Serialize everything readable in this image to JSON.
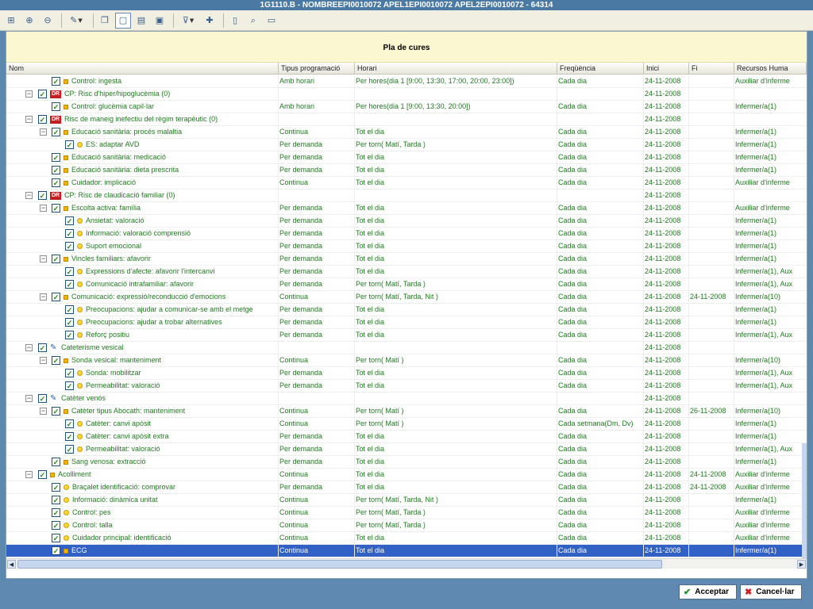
{
  "window": {
    "title": "1G1110.B - NOMBREEPI0010072 APEL1EPI0010072 APEL2EPI0010072 - 64314"
  },
  "toolbar": {
    "buttons": [
      {
        "name": "expand-tree-icon",
        "glyph": "⊞"
      },
      {
        "name": "add-node-icon",
        "glyph": "⊕"
      },
      {
        "name": "remove-node-icon",
        "glyph": "⊖"
      },
      {
        "name": "edit-pencil-icon",
        "glyph": "✎",
        "dropdown": true
      },
      {
        "name": "copy-icon",
        "glyph": "❐"
      },
      {
        "name": "page-view-icon",
        "glyph": "▢",
        "active": true
      },
      {
        "name": "book-icon",
        "glyph": "▤"
      },
      {
        "name": "window-icon",
        "glyph": "▣"
      },
      {
        "name": "filter-icon",
        "glyph": "⊽",
        "dropdown": true
      },
      {
        "name": "pin-icon",
        "glyph": "✚"
      },
      {
        "name": "document-icon",
        "glyph": "▯"
      },
      {
        "name": "search-icon",
        "glyph": "⌕"
      },
      {
        "name": "monitor-icon",
        "glyph": "▭"
      }
    ]
  },
  "plan": {
    "title": "Pla de cures"
  },
  "columns": [
    "Nom",
    "Tipus programació",
    "Horari",
    "Freqüència",
    "Inici",
    "Fi",
    "Recursos Huma"
  ],
  "rows": [
    {
      "level": 3,
      "icon": "sq",
      "name": "Control: ingesta",
      "tipus": "Amb horari",
      "horari": "Per hores(dia 1 [9:00, 13:30, 17:00, 20:00, 23:00])",
      "freq": "Cada dia",
      "inici": "24-11-2008",
      "fi": "",
      "rec": "Auxiliar d'inferme"
    },
    {
      "level": 1,
      "exp": "−",
      "icon": "dr",
      "name": "CP: Risc d'hiper/hipoglucèmia (0)",
      "tipus": "",
      "horari": "",
      "freq": "",
      "inici": "24-11-2008",
      "fi": "",
      "rec": ""
    },
    {
      "level": 3,
      "icon": "sq",
      "name": "Control: glucèmia capil·lar",
      "tipus": "Amb horari",
      "horari": "Per hores(dia 1 [9:00, 13:30, 20:00])",
      "freq": "Cada dia",
      "inici": "24-11-2008",
      "fi": "",
      "rec": "Infermer/a(1)"
    },
    {
      "level": 1,
      "exp": "−",
      "icon": "dr",
      "name": "Risc de maneig inefectiu del règim terapèutic (0)",
      "tipus": "",
      "horari": "",
      "freq": "",
      "inici": "24-11-2008",
      "fi": "",
      "rec": ""
    },
    {
      "level": 2,
      "exp": "−",
      "icon": "sq",
      "name": "Educació sanitària: procés malaltia",
      "tipus": "Continua",
      "horari": "Tot el dia",
      "freq": "Cada dia",
      "inici": "24-11-2008",
      "fi": "",
      "rec": "Infermer/a(1)"
    },
    {
      "level": 4,
      "icon": "circ",
      "name": "ES: adaptar AVD",
      "tipus": "Per demanda",
      "horari": "Per torn( Matí, Tarda )",
      "freq": "Cada dia",
      "inici": "24-11-2008",
      "fi": "",
      "rec": "Infermer/a(1)"
    },
    {
      "level": 3,
      "icon": "sq",
      "name": "Educació sanitària: medicació",
      "tipus": "Per demanda",
      "horari": "Tot el dia",
      "freq": "Cada dia",
      "inici": "24-11-2008",
      "fi": "",
      "rec": "Infermer/a(1)"
    },
    {
      "level": 3,
      "icon": "sq",
      "name": "Educació sanitària: dieta prescrita",
      "tipus": "Per demanda",
      "horari": "Tot el dia",
      "freq": "Cada dia",
      "inici": "24-11-2008",
      "fi": "",
      "rec": "Infermer/a(1)"
    },
    {
      "level": 3,
      "icon": "sq",
      "name": "Cuidador: implicació",
      "tipus": "Continua",
      "horari": "Tot el dia",
      "freq": "Cada dia",
      "inici": "24-11-2008",
      "fi": "",
      "rec": "Auxiliar d'inferme"
    },
    {
      "level": 1,
      "exp": "−",
      "icon": "dr",
      "name": "CP: Risc de claudicació familiar (0)",
      "tipus": "",
      "horari": "",
      "freq": "",
      "inici": "24-11-2008",
      "fi": "",
      "rec": ""
    },
    {
      "level": 2,
      "exp": "−",
      "icon": "sq",
      "name": "Escolta activa: família",
      "tipus": "Per demanda",
      "horari": "Tot el dia",
      "freq": "Cada dia",
      "inici": "24-11-2008",
      "fi": "",
      "rec": "Auxiliar d'inferme"
    },
    {
      "level": 4,
      "icon": "circ",
      "name": "Ansietat: valoració",
      "tipus": "Per demanda",
      "horari": "Tot el dia",
      "freq": "Cada dia",
      "inici": "24-11-2008",
      "fi": "",
      "rec": "Infermer/a(1)"
    },
    {
      "level": 4,
      "icon": "circ",
      "name": "Informació: valoració comprensió",
      "tipus": "Per demanda",
      "horari": "Tot el dia",
      "freq": "Cada dia",
      "inici": "24-11-2008",
      "fi": "",
      "rec": "Infermer/a(1)"
    },
    {
      "level": 4,
      "icon": "circ",
      "name": "Suport emocional",
      "tipus": "Per demanda",
      "horari": "Tot el dia",
      "freq": "Cada dia",
      "inici": "24-11-2008",
      "fi": "",
      "rec": "Infermer/a(1)"
    },
    {
      "level": 2,
      "exp": "−",
      "icon": "sq",
      "name": "Vincles familiars: afavorir",
      "tipus": "Per demanda",
      "horari": "Tot el dia",
      "freq": "Cada dia",
      "inici": "24-11-2008",
      "fi": "",
      "rec": "Infermer/a(1)"
    },
    {
      "level": 4,
      "icon": "circ",
      "name": "Expressions d'afecte: afavorir l'intercanvi",
      "tipus": "Per demanda",
      "horari": "Tot el dia",
      "freq": "Cada dia",
      "inici": "24-11-2008",
      "fi": "",
      "rec": "Infermer/a(1), Aux"
    },
    {
      "level": 4,
      "icon": "circ",
      "name": "Comunicació intrafamiliar: afavorir",
      "tipus": "Per demanda",
      "horari": "Per torn( Matí, Tarda )",
      "freq": "Cada dia",
      "inici": "24-11-2008",
      "fi": "",
      "rec": "Infermer/a(1), Aux"
    },
    {
      "level": 2,
      "exp": "−",
      "icon": "sq",
      "name": "Comunicació: expressió/reconducció d'emocions",
      "tipus": "Continua",
      "horari": "Per torn( Matí, Tarda, Nit )",
      "freq": "Cada dia",
      "inici": "24-11-2008",
      "fi": "24-11-2008",
      "rec": "Infermer/a(10)"
    },
    {
      "level": 4,
      "icon": "circ",
      "name": "Preocupacions: ajudar a comunicar-se amb el metge",
      "tipus": "Per demanda",
      "horari": "Tot el dia",
      "freq": "Cada dia",
      "inici": "24-11-2008",
      "fi": "",
      "rec": "Infermer/a(1)"
    },
    {
      "level": 4,
      "icon": "circ",
      "name": "Preocupacions: ajudar a trobar alternatives",
      "tipus": "Per demanda",
      "horari": "Tot el dia",
      "freq": "Cada dia",
      "inici": "24-11-2008",
      "fi": "",
      "rec": "Infermer/a(1)"
    },
    {
      "level": 4,
      "icon": "circ",
      "name": "Reforç positiu",
      "tipus": "Per demanda",
      "horari": "Tot el dia",
      "freq": "Cada dia",
      "inici": "24-11-2008",
      "fi": "",
      "rec": "Infermer/a(1), Aux"
    },
    {
      "level": 1,
      "exp": "−",
      "icon": "pen",
      "name": "Cateterisme vesical",
      "tipus": "",
      "horari": "",
      "freq": "",
      "inici": "24-11-2008",
      "fi": "",
      "rec": ""
    },
    {
      "level": 2,
      "exp": "−",
      "icon": "sq",
      "name": "Sonda vesical: manteniment",
      "tipus": "Continua",
      "horari": "Per torn( Matí )",
      "freq": "Cada dia",
      "inici": "24-11-2008",
      "fi": "",
      "rec": "Infermer/a(10)"
    },
    {
      "level": 4,
      "icon": "circ",
      "name": "Sonda: mobilitzar",
      "tipus": "Per demanda",
      "horari": "Tot el dia",
      "freq": "Cada dia",
      "inici": "24-11-2008",
      "fi": "",
      "rec": "Infermer/a(1), Aux"
    },
    {
      "level": 4,
      "icon": "circ",
      "name": "Permeabilitat: valoració",
      "tipus": "Per demanda",
      "horari": "Tot el dia",
      "freq": "Cada dia",
      "inici": "24-11-2008",
      "fi": "",
      "rec": "Infermer/a(1), Aux"
    },
    {
      "level": 1,
      "exp": "−",
      "icon": "pen",
      "name": "Catèter venós",
      "tipus": "",
      "horari": "",
      "freq": "",
      "inici": "24-11-2008",
      "fi": "",
      "rec": ""
    },
    {
      "level": 2,
      "exp": "−",
      "icon": "sq",
      "name": "Catèter tipus Abocath: manteniment",
      "tipus": "Continua",
      "horari": "Per torn( Matí )",
      "freq": "Cada dia",
      "inici": "24-11-2008",
      "fi": "26-11-2008",
      "rec": "Infermer/a(10)"
    },
    {
      "level": 4,
      "icon": "circ",
      "name": "Catèter: canvi apòsit",
      "tipus": "Continua",
      "horari": "Per torn( Matí )",
      "freq": "Cada setmana(Dm, Dv)",
      "inici": "24-11-2008",
      "fi": "",
      "rec": "Infermer/a(1)"
    },
    {
      "level": 4,
      "icon": "circ",
      "name": "Catèter: canvi apòsit extra",
      "tipus": "Per demanda",
      "horari": "Tot el dia",
      "freq": "Cada dia",
      "inici": "24-11-2008",
      "fi": "",
      "rec": "Infermer/a(1)"
    },
    {
      "level": 4,
      "icon": "circ",
      "name": "Permeabilitat: valoració",
      "tipus": "Per demanda",
      "horari": "Tot el dia",
      "freq": "Cada dia",
      "inici": "24-11-2008",
      "fi": "",
      "rec": "Infermer/a(1), Aux"
    },
    {
      "level": 2,
      "icon": "sq",
      "name": "Sang venosa: extracció",
      "tipus": "Per demanda",
      "horari": "Tot el dia",
      "freq": "Cada dia",
      "inici": "24-11-2008",
      "fi": "",
      "rec": "Infermer/a(1)"
    },
    {
      "level": 1,
      "exp": "−",
      "icon": "sq",
      "name": "Acolliment",
      "tipus": "Continua",
      "horari": "Tot el dia",
      "freq": "Cada dia",
      "inici": "24-11-2008",
      "fi": "24-11-2008",
      "rec": "Auxiliar d'inferme"
    },
    {
      "level": 3,
      "icon": "circ",
      "name": "Braçalet identificació: comprovar",
      "tipus": "Per demanda",
      "horari": "Tot el dia",
      "freq": "Cada dia",
      "inici": "24-11-2008",
      "fi": "24-11-2008",
      "rec": "Auxiliar d'inferme"
    },
    {
      "level": 3,
      "icon": "circ",
      "name": "Informació: dinàmica unitat",
      "tipus": "Continua",
      "horari": "Per torn( Matí, Tarda, Nit )",
      "freq": "Cada dia",
      "inici": "24-11-2008",
      "fi": "",
      "rec": "Infermer/a(1)"
    },
    {
      "level": 3,
      "icon": "circ",
      "name": "Control: pes",
      "tipus": "Continua",
      "horari": "Per torn( Matí, Tarda )",
      "freq": "Cada dia",
      "inici": "24-11-2008",
      "fi": "",
      "rec": "Auxiliar d'inferme"
    },
    {
      "level": 3,
      "icon": "circ",
      "name": "Control: talla",
      "tipus": "Continua",
      "horari": "Per torn( Matí, Tarda )",
      "freq": "Cada dia",
      "inici": "24-11-2008",
      "fi": "",
      "rec": "Auxiliar d'inferme"
    },
    {
      "level": 3,
      "icon": "circ",
      "name": "Cuidador principal: identificació",
      "tipus": "Continua",
      "horari": "Tot el dia",
      "freq": "Cada dia",
      "inici": "24-11-2008",
      "fi": "",
      "rec": "Auxiliar d'inferme"
    },
    {
      "level": 2,
      "icon": "sq",
      "name": "ECG",
      "tipus": "Continua",
      "horari": "Tot el dia",
      "freq": "Cada dia",
      "inici": "24-11-2008",
      "fi": "",
      "rec": "Infermer/a(1)",
      "selected": true
    }
  ],
  "buttons": {
    "accept": "Acceptar",
    "cancel": "Cancel·lar"
  }
}
